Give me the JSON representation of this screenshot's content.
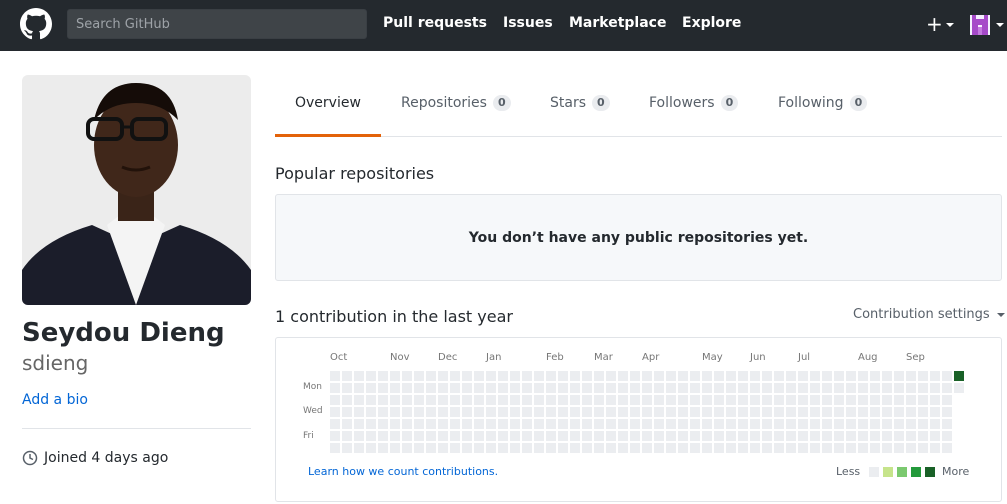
{
  "header": {
    "search_placeholder": "Search GitHub",
    "nav": [
      "Pull requests",
      "Issues",
      "Marketplace",
      "Explore"
    ],
    "plus_label": "+"
  },
  "profile": {
    "fullname": "Seydou Dieng",
    "username": "sdieng",
    "add_bio": "Add a bio",
    "joined": "Joined 4 days ago"
  },
  "tabs": [
    {
      "label": "Overview",
      "count": null,
      "active": true
    },
    {
      "label": "Repositories",
      "count": "0"
    },
    {
      "label": "Stars",
      "count": "0"
    },
    {
      "label": "Followers",
      "count": "0"
    },
    {
      "label": "Following",
      "count": "0"
    }
  ],
  "popular": {
    "title": "Popular repositories",
    "empty_message": "You don’t have any public repositories yet."
  },
  "contributions": {
    "title": "1 contribution in the last year",
    "settings": "Contribution settings",
    "months": [
      "Oct",
      "Nov",
      "Dec",
      "Jan",
      "Feb",
      "Mar",
      "Apr",
      "May",
      "Jun",
      "Jul",
      "Aug",
      "Sep"
    ],
    "weekdays": [
      "Mon",
      "Wed",
      "Fri"
    ],
    "learn_link": "Learn how we count contributions.",
    "legend_less": "Less",
    "legend_more": "More",
    "colors": [
      "#ebedf0",
      "#c6e48b",
      "#7bc96f",
      "#239a3b",
      "#196127"
    ]
  }
}
